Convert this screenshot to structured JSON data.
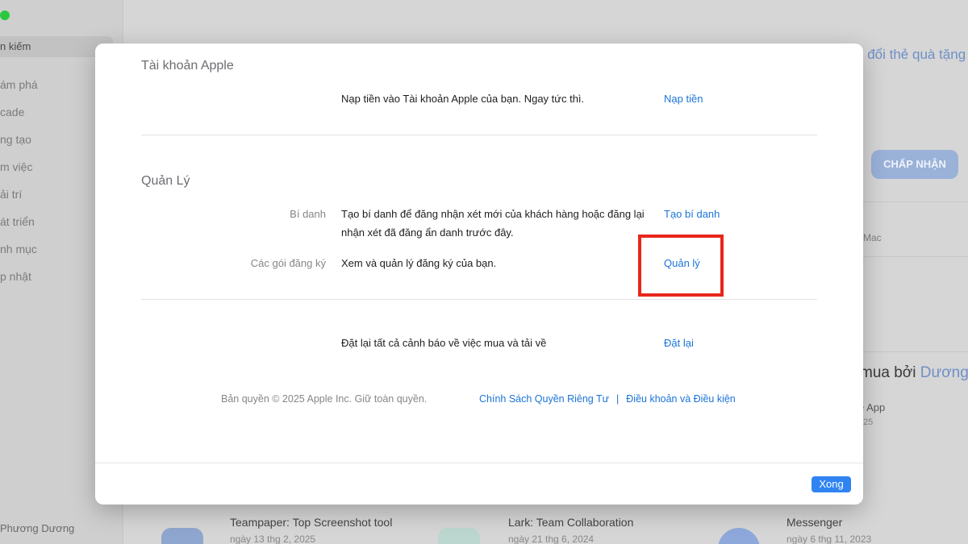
{
  "background": {
    "sidebar": {
      "search_fragment": "n kiếm",
      "nav_fragments": [
        "ám phá",
        "cade",
        "ng tạo",
        "m việc",
        "ải trí",
        "át triển",
        "nh mục",
        "p nhật"
      ],
      "user_fragment": "Phương Dương"
    },
    "main": {
      "top_link_fragment": "y đổi thẻ quà tặng",
      "accept_button": "CHẤP NHẬN",
      "platform_fragment": "Mac",
      "bought_by_fragment": "mua bởi",
      "bought_by_name_fragment": "Dương",
      "app_fragment": "e App",
      "app_date_fragment": "25",
      "cards": [
        {
          "title": "Teampaper: Top Screenshot tool",
          "date": "ngày 13 thg 2, 2025"
        },
        {
          "title": "Lark: Team Collaboration",
          "date": "ngày 21 thg 6, 2024"
        },
        {
          "title": "Messenger",
          "date": "ngày 6 thg 11, 2023"
        }
      ]
    }
  },
  "modal": {
    "sections": {
      "apple_account": {
        "title": "Tài khoản Apple",
        "add_funds": {
          "description": "Nạp tiền vào Tài khoản Apple của bạn. Ngay tức thì.",
          "action": "Nạp tiền"
        }
      },
      "manage": {
        "title": "Quản Lý",
        "alias": {
          "label": "Bí danh",
          "description": "Tạo bí danh để đăng nhận xét mới của khách hàng hoặc đăng lại nhận xét đã đăng ẩn danh trước đây.",
          "action": "Tạo bí danh"
        },
        "subscriptions": {
          "label": "Các gói đăng ký",
          "description": "Xem và quản lý đăng ký của bạn.",
          "action": "Quản lý"
        }
      },
      "reset": {
        "description": "Đặt lại tất cả cảnh báo về việc mua và tải về",
        "action": "Đặt lại"
      }
    },
    "footer": {
      "copyright": "Bản quyền © 2025 Apple Inc. Giữ toàn quyền.",
      "privacy_link": "Chính Sách Quyền Riêng Tư",
      "separator": "|",
      "terms_link": "Điều khoản và Điều kiện"
    },
    "done_button": "Xong"
  },
  "colors": {
    "link": "#1a74d6",
    "highlight": "#e8261b",
    "primary_button": "#2f84f2"
  }
}
